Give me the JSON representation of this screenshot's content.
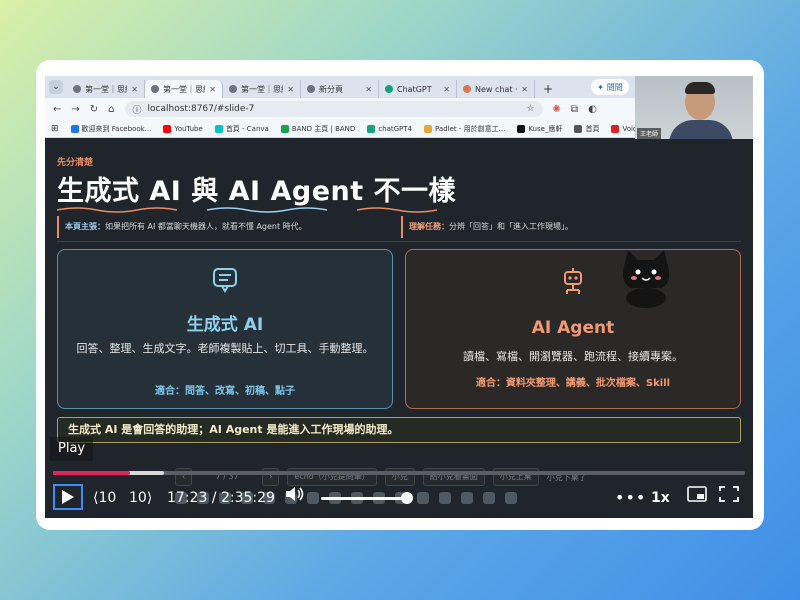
{
  "browser": {
    "tabs": [
      {
        "label": "第一堂｜思維",
        "active": false
      },
      {
        "label": "第一堂｜思維",
        "active": true
      },
      {
        "label": "第一堂｜思維",
        "active": false
      },
      {
        "label": "新分頁",
        "active": false
      },
      {
        "label": "ChatGPT",
        "active": false
      },
      {
        "label": "New chat · C",
        "active": false
      }
    ],
    "new_tab": "+",
    "gemini_label": "問問",
    "url": "localhost:8767/#slide-7",
    "bookmarks": [
      "歡迎來到 Facebook...",
      "YouTube",
      "首頁 - Canva",
      "BAND 主頁 | BAND",
      "chatGPT4",
      "Padlet - 用於創意工...",
      "Kuse_應軒",
      "首頁",
      "VoiceTube（看影"
    ]
  },
  "webcam": {
    "name_tag": "王老師"
  },
  "slide": {
    "kicker": "先分清楚",
    "title": "生成式 AI 與 AI Agent 不一樣",
    "note_left_label": "本頁主張：",
    "note_left_text": "如果把所有 AI 都當聊天機器人，就看不懂 Agent 時代。",
    "note_right_label": "理解任務：",
    "note_right_text": "分辨「回答」和「進入工作現場」。",
    "left_panel": {
      "heading": "生成式 AI",
      "body": "回答、整理、生成文字。老師複製貼上、切工具、手動整理。",
      "fit": "適合：問答、改寫、初稿、點子"
    },
    "right_panel": {
      "heading": "AI Agent",
      "body": "讀檔、寫檔、開瀏覽器、跑流程、接續專案。",
      "fit": "適合：資料夾整理、講義、批次檔案、Skill"
    },
    "summary": "生成式 AI 是會回答的助理；AI Agent 是能進入工作現場的助理。",
    "toolbar": {
      "prev": "‹",
      "page": "7 / 37",
      "next": "›",
      "echo": "echo（小克提問筆）",
      "xiaoke": "小克",
      "ask": "給小克看畫面",
      "up": "小克上桌",
      "hint": "小克下桌了"
    }
  },
  "player": {
    "tooltip": "Play",
    "rewind_label": "10",
    "forward_label": "10",
    "time": "17:23 / 2:35:29",
    "speed": "1x",
    "progress_fraction": 0.111,
    "buffered_fraction": 0.16,
    "volume_fraction": 0.95
  }
}
